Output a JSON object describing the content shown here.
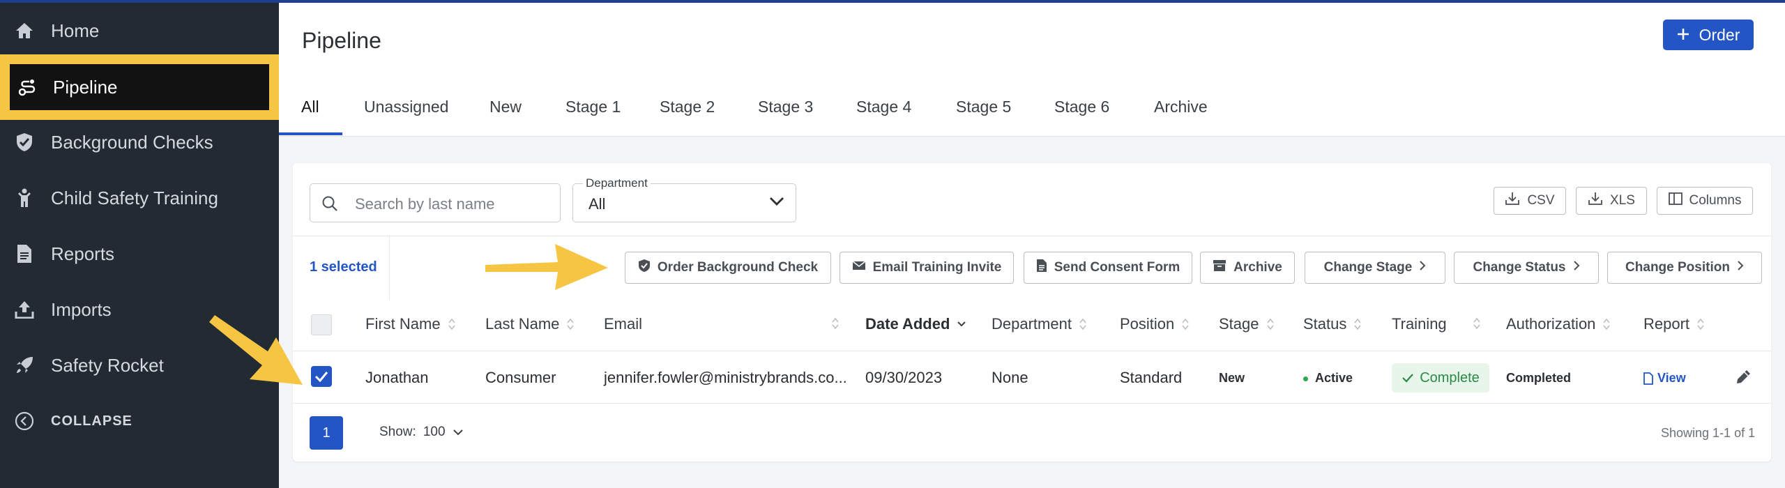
{
  "sidebar": {
    "items": [
      {
        "label": "Home",
        "icon": "home-icon"
      },
      {
        "label": "Pipeline",
        "icon": "pipeline-icon"
      },
      {
        "label": "Background Checks",
        "icon": "shield-check-icon"
      },
      {
        "label": "Child Safety Training",
        "icon": "child-icon"
      },
      {
        "label": "Reports",
        "icon": "document-icon"
      },
      {
        "label": "Imports",
        "icon": "upload-icon"
      },
      {
        "label": "Safety Rocket",
        "icon": "rocket-icon"
      }
    ],
    "collapse_label": "COLLAPSE"
  },
  "header": {
    "title": "Pipeline",
    "order_label": "Order"
  },
  "tabs": [
    "All",
    "Unassigned",
    "New",
    "Stage 1",
    "Stage 2",
    "Stage 3",
    "Stage 4",
    "Stage 5",
    "Stage 6",
    "Archive"
  ],
  "filters": {
    "search_placeholder": "Search by last name",
    "department_label": "Department",
    "department_value": "All"
  },
  "exports": {
    "csv": "CSV",
    "xls": "XLS",
    "columns": "Columns"
  },
  "actions": {
    "selected": "1 selected",
    "order_background_check": "Order Background Check",
    "email_training_invite": "Email Training Invite",
    "send_consent_form": "Send Consent Form",
    "archive": "Archive",
    "change_stage": "Change Stage",
    "change_status": "Change Status",
    "change_position": "Change Position"
  },
  "table": {
    "columns": [
      "First Name",
      "Last Name",
      "Email",
      "Date Added",
      "Department",
      "Position",
      "Stage",
      "Status",
      "Training",
      "Authorization",
      "Report"
    ],
    "rows": [
      {
        "first_name": "Jonathan",
        "last_name": "Consumer",
        "email": "jennifer.fowler@ministrybrands.co...",
        "date_added": "09/30/2023",
        "department": "None",
        "position": "Standard",
        "stage": "New",
        "status": "Active",
        "training": "Complete",
        "authorization": "Completed",
        "report": "View"
      }
    ]
  },
  "pagination": {
    "page": "1",
    "show_label": "Show:",
    "show_value": "100",
    "showing": "Showing 1-1 of 1"
  },
  "colors": {
    "accent": "#2356c4",
    "sidebar": "#222b33",
    "highlight": "#f5c543",
    "active_status": "#2fa84f"
  }
}
